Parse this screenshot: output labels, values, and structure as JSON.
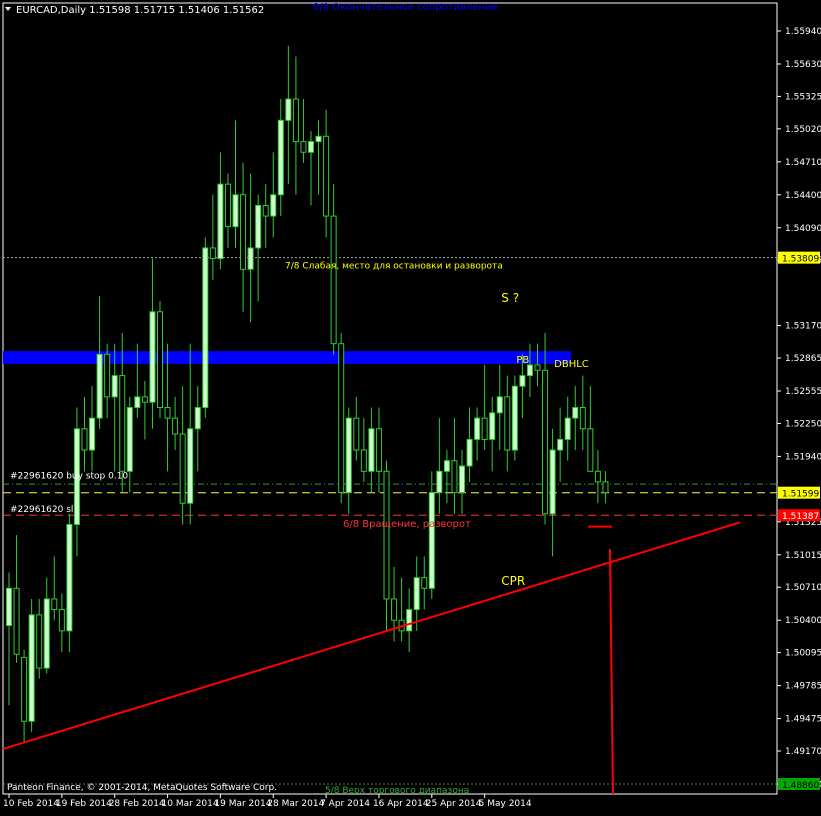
{
  "window": {
    "symbol_header": "EURCAD,Daily  1.51598 1.51715 1.51406 1.51562",
    "copyright": "Panteon Finance, © 2001-2014, MetaQuotes Software Corp."
  },
  "colors": {
    "background": "#000000",
    "bull_candle": "#ccffcc",
    "bear_candle": "#000000",
    "wick": "#33cc33",
    "blue_zone": "#0000ff",
    "trendline": "#ff0000",
    "annotation_yellow": "#ffff00",
    "price_box_yellow": "#ffff00",
    "sl_line": "#ff0000",
    "grid_text": "#ffffff"
  },
  "chart_data": {
    "type": "candlestick",
    "title": "EURCAD,Daily",
    "ylim": [
      1.4885,
      1.563
    ],
    "y_ticks": [
      "1.55940",
      "1.55630",
      "1.55325",
      "1.55020",
      "1.54710",
      "1.54400",
      "1.54090",
      "1.53785",
      "1.53170",
      "1.52865",
      "1.52555",
      "1.52250",
      "1.51940",
      "1.51325",
      "1.51015",
      "1.50710",
      "1.50400",
      "1.50095",
      "1.49785",
      "1.49475",
      "1.49170",
      "1.48860"
    ],
    "x_ticks": [
      "10 Feb 2014",
      "19 Feb 2014",
      "28 Feb 2014",
      "10 Mar 2014",
      "19 Mar 2014",
      "28 Mar 2014",
      "7 Apr 2014",
      "16 Apr 2014",
      "25 Apr 2014",
      "5 May 2014"
    ],
    "candles": [
      {
        "o": 1.5035,
        "h": 1.5085,
        "l": 1.496,
        "c": 1.507
      },
      {
        "o": 1.507,
        "h": 1.512,
        "l": 1.5,
        "c": 1.5008
      },
      {
        "o": 1.5005,
        "h": 1.5012,
        "l": 1.4925,
        "c": 1.4945
      },
      {
        "o": 1.4945,
        "h": 1.506,
        "l": 1.4935,
        "c": 1.5045
      },
      {
        "o": 1.5045,
        "h": 1.506,
        "l": 1.4985,
        "c": 1.4995
      },
      {
        "o": 1.4995,
        "h": 1.508,
        "l": 1.499,
        "c": 1.506
      },
      {
        "o": 1.506,
        "h": 1.51,
        "l": 1.504,
        "c": 1.505
      },
      {
        "o": 1.505,
        "h": 1.5065,
        "l": 1.501,
        "c": 1.503
      },
      {
        "o": 1.503,
        "h": 1.514,
        "l": 1.501,
        "c": 1.513
      },
      {
        "o": 1.513,
        "h": 1.524,
        "l": 1.51,
        "c": 1.522
      },
      {
        "o": 1.522,
        "h": 1.525,
        "l": 1.518,
        "c": 1.52
      },
      {
        "o": 1.52,
        "h": 1.526,
        "l": 1.518,
        "c": 1.523
      },
      {
        "o": 1.523,
        "h": 1.5345,
        "l": 1.522,
        "c": 1.529
      },
      {
        "o": 1.529,
        "h": 1.53,
        "l": 1.523,
        "c": 1.525
      },
      {
        "o": 1.525,
        "h": 1.53,
        "l": 1.518,
        "c": 1.527
      },
      {
        "o": 1.527,
        "h": 1.531,
        "l": 1.516,
        "c": 1.518
      },
      {
        "o": 1.518,
        "h": 1.525,
        "l": 1.516,
        "c": 1.524
      },
      {
        "o": 1.524,
        "h": 1.53,
        "l": 1.523,
        "c": 1.525
      },
      {
        "o": 1.525,
        "h": 1.5265,
        "l": 1.521,
        "c": 1.5245
      },
      {
        "o": 1.5245,
        "h": 1.538,
        "l": 1.522,
        "c": 1.533
      },
      {
        "o": 1.533,
        "h": 1.534,
        "l": 1.523,
        "c": 1.524
      },
      {
        "o": 1.524,
        "h": 1.53,
        "l": 1.518,
        "c": 1.523
      },
      {
        "o": 1.523,
        "h": 1.525,
        "l": 1.52,
        "c": 1.5215
      },
      {
        "o": 1.5215,
        "h": 1.526,
        "l": 1.513,
        "c": 1.515
      },
      {
        "o": 1.515,
        "h": 1.53,
        "l": 1.513,
        "c": 1.522
      },
      {
        "o": 1.522,
        "h": 1.526,
        "l": 1.518,
        "c": 1.524
      },
      {
        "o": 1.524,
        "h": 1.54,
        "l": 1.523,
        "c": 1.539
      },
      {
        "o": 1.539,
        "h": 1.544,
        "l": 1.536,
        "c": 1.538
      },
      {
        "o": 1.538,
        "h": 1.548,
        "l": 1.537,
        "c": 1.545
      },
      {
        "o": 1.545,
        "h": 1.546,
        "l": 1.539,
        "c": 1.541
      },
      {
        "o": 1.541,
        "h": 1.551,
        "l": 1.539,
        "c": 1.544
      },
      {
        "o": 1.544,
        "h": 1.547,
        "l": 1.533,
        "c": 1.537
      },
      {
        "o": 1.537,
        "h": 1.546,
        "l": 1.532,
        "c": 1.539
      },
      {
        "o": 1.539,
        "h": 1.544,
        "l": 1.534,
        "c": 1.543
      },
      {
        "o": 1.543,
        "h": 1.545,
        "l": 1.539,
        "c": 1.542
      },
      {
        "o": 1.542,
        "h": 1.548,
        "l": 1.54,
        "c": 1.544
      },
      {
        "o": 1.544,
        "h": 1.553,
        "l": 1.542,
        "c": 1.551
      },
      {
        "o": 1.551,
        "h": 1.558,
        "l": 1.545,
        "c": 1.553
      },
      {
        "o": 1.553,
        "h": 1.557,
        "l": 1.544,
        "c": 1.549
      },
      {
        "o": 1.549,
        "h": 1.553,
        "l": 1.547,
        "c": 1.548
      },
      {
        "o": 1.548,
        "h": 1.55,
        "l": 1.543,
        "c": 1.549
      },
      {
        "o": 1.549,
        "h": 1.551,
        "l": 1.544,
        "c": 1.5495
      },
      {
        "o": 1.5495,
        "h": 1.552,
        "l": 1.54,
        "c": 1.542
      },
      {
        "o": 1.542,
        "h": 1.545,
        "l": 1.529,
        "c": 1.53
      },
      {
        "o": 1.53,
        "h": 1.531,
        "l": 1.515,
        "c": 1.516
      },
      {
        "o": 1.516,
        "h": 1.524,
        "l": 1.514,
        "c": 1.523
      },
      {
        "o": 1.523,
        "h": 1.525,
        "l": 1.519,
        "c": 1.52
      },
      {
        "o": 1.52,
        "h": 1.523,
        "l": 1.517,
        "c": 1.518
      },
      {
        "o": 1.518,
        "h": 1.524,
        "l": 1.516,
        "c": 1.522
      },
      {
        "o": 1.522,
        "h": 1.524,
        "l": 1.516,
        "c": 1.518
      },
      {
        "o": 1.518,
        "h": 1.519,
        "l": 1.503,
        "c": 1.506
      },
      {
        "o": 1.506,
        "h": 1.509,
        "l": 1.502,
        "c": 1.504
      },
      {
        "o": 1.504,
        "h": 1.508,
        "l": 1.502,
        "c": 1.503
      },
      {
        "o": 1.503,
        "h": 1.507,
        "l": 1.501,
        "c": 1.505
      },
      {
        "o": 1.505,
        "h": 1.51,
        "l": 1.503,
        "c": 1.508
      },
      {
        "o": 1.508,
        "h": 1.51,
        "l": 1.505,
        "c": 1.507
      },
      {
        "o": 1.507,
        "h": 1.518,
        "l": 1.506,
        "c": 1.516
      },
      {
        "o": 1.516,
        "h": 1.523,
        "l": 1.514,
        "c": 1.518
      },
      {
        "o": 1.518,
        "h": 1.52,
        "l": 1.515,
        "c": 1.519
      },
      {
        "o": 1.519,
        "h": 1.523,
        "l": 1.514,
        "c": 1.516
      },
      {
        "o": 1.516,
        "h": 1.52,
        "l": 1.514,
        "c": 1.5185
      },
      {
        "o": 1.5185,
        "h": 1.524,
        "l": 1.517,
        "c": 1.521
      },
      {
        "o": 1.521,
        "h": 1.524,
        "l": 1.519,
        "c": 1.523
      },
      {
        "o": 1.523,
        "h": 1.528,
        "l": 1.52,
        "c": 1.521
      },
      {
        "o": 1.521,
        "h": 1.525,
        "l": 1.518,
        "c": 1.5235
      },
      {
        "o": 1.5235,
        "h": 1.528,
        "l": 1.52,
        "c": 1.525
      },
      {
        "o": 1.525,
        "h": 1.527,
        "l": 1.518,
        "c": 1.52
      },
      {
        "o": 1.52,
        "h": 1.527,
        "l": 1.519,
        "c": 1.526
      },
      {
        "o": 1.526,
        "h": 1.529,
        "l": 1.523,
        "c": 1.527
      },
      {
        "o": 1.527,
        "h": 1.53,
        "l": 1.525,
        "c": 1.528
      },
      {
        "o": 1.528,
        "h": 1.53,
        "l": 1.526,
        "c": 1.5275
      },
      {
        "o": 1.5275,
        "h": 1.531,
        "l": 1.513,
        "c": 1.514
      },
      {
        "o": 1.514,
        "h": 1.522,
        "l": 1.51,
        "c": 1.52
      },
      {
        "o": 1.52,
        "h": 1.524,
        "l": 1.517,
        "c": 1.521
      },
      {
        "o": 1.521,
        "h": 1.525,
        "l": 1.519,
        "c": 1.523
      },
      {
        "o": 1.523,
        "h": 1.526,
        "l": 1.52,
        "c": 1.524
      },
      {
        "o": 1.524,
        "h": 1.527,
        "l": 1.52,
        "c": 1.522
      },
      {
        "o": 1.522,
        "h": 1.526,
        "l": 1.518,
        "c": 1.518
      },
      {
        "o": 1.518,
        "h": 1.52,
        "l": 1.515,
        "c": 1.517
      },
      {
        "o": 1.517,
        "h": 1.518,
        "l": 1.515,
        "c": 1.516
      }
    ],
    "levels": [
      {
        "price": 1.53809,
        "style": "dotted",
        "color": "#aaaaaa",
        "label": "7/8 Слабая, место для остановки и разворота",
        "label_color": "#ffff00",
        "box_label": "1.53809",
        "box_bg": "#ffff00",
        "box_fg": "#000000"
      },
      {
        "price": 1.51599,
        "style": "dashed",
        "color": "#ffff33",
        "label": "#22961620 buy stop 0.10",
        "label_color": "#ffffff",
        "box_label": "1.51599",
        "box_bg": "#ffff00",
        "box_fg": "#000000"
      },
      {
        "price": 1.51387,
        "style": "dashed",
        "color": "#ff3333",
        "label": "#22961620 sl",
        "label_color": "#ffffff",
        "box_label": "1.51387",
        "box_bg": "#ff0000",
        "box_fg": "#ffffff"
      },
      {
        "price": 1.4886,
        "style": "dotted",
        "color": "#339933",
        "label": "5/8 Верх торгового диапазона",
        "label_color": "#33aa33",
        "box_label": "1.48860",
        "box_bg": "#00aa00",
        "box_fg": "#000000"
      }
    ],
    "green_dashdot_price": 1.5168,
    "blue_zone": {
      "top": 1.5293,
      "bottom": 1.5281
    },
    "top_label": "8/8 Окончательное сопротивление",
    "mid_label_red": "6/8 Вращение, разворот",
    "annotations": [
      {
        "text": "S ?",
        "price": 1.5339,
        "candle": 66
      },
      {
        "text": "PB",
        "price": 1.5282,
        "candle": 68
      },
      {
        "text": "DBHLC",
        "price": 1.5278,
        "candle": 73
      },
      {
        "text": "CPR",
        "price": 1.5073,
        "candle": 66
      }
    ]
  }
}
